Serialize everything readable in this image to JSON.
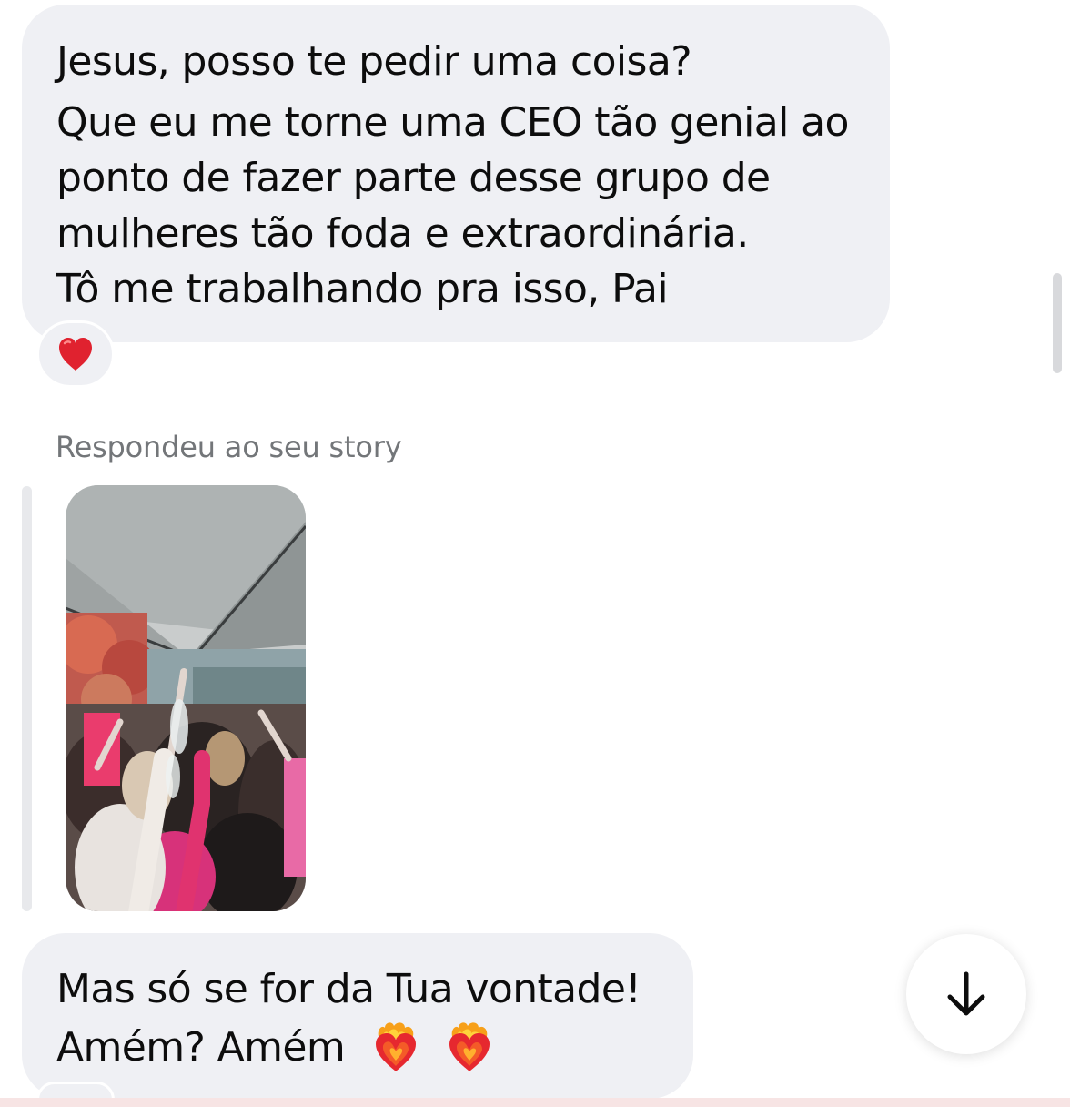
{
  "thread": {
    "message_1": {
      "lines": [
        "Jesus, posso te pedir uma coisa?",
        "Que eu me torne uma CEO tão genial ao",
        "ponto de fazer parte desse grupo de",
        "mulheres tão foda e extraordinária.",
        "Tô me trabalhando pra isso, Pai"
      ],
      "reaction_icon": "red-heart-icon"
    },
    "story_reply": {
      "caption": "Respondeu ao seu story",
      "thumbnail_icon": "story-photo-thumbnail"
    },
    "message_2": {
      "line_1": "Mas só se for da Tua vontade!",
      "line_2": "Amém? Amém",
      "emoji_icons": [
        "heart-on-fire-icon",
        "heart-on-fire-icon"
      ]
    },
    "scroll_button_icon": "arrow-down-icon"
  },
  "colors": {
    "bubble_background": "#eff0f4",
    "text_primary": "#0d0d0d",
    "caption_text": "#737679",
    "heart_red": "#e0222f"
  }
}
